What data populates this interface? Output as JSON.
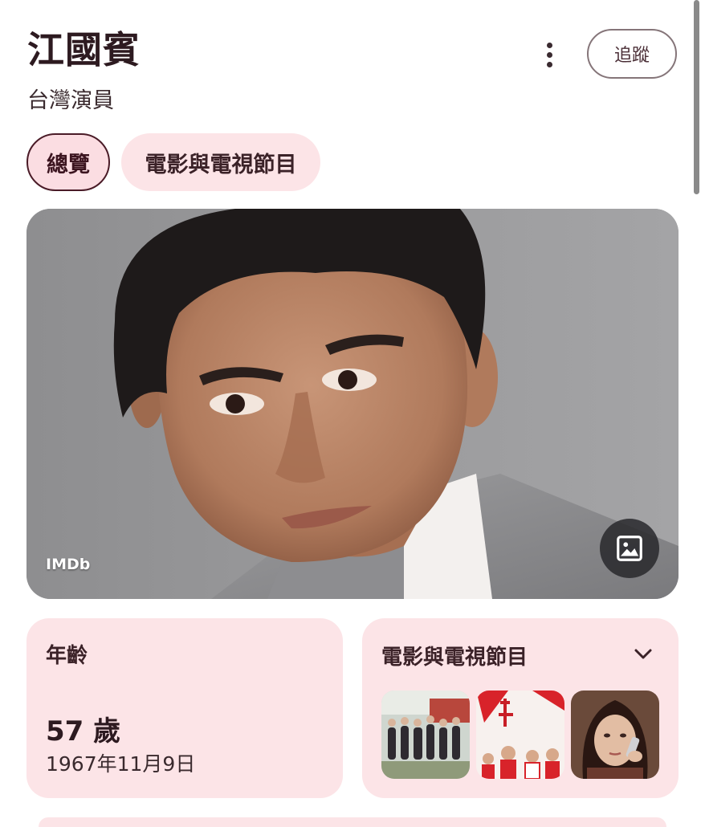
{
  "header": {
    "title": "江國賓",
    "subtitle": "台灣演員",
    "more_icon": "more-vert-icon",
    "follow_label": "追蹤"
  },
  "tabs": [
    {
      "label": "總覽",
      "selected": true
    },
    {
      "label": "電影與電視節目",
      "selected": false
    }
  ],
  "hero": {
    "source_label": "IMDb",
    "image_button_icon": "image-icon"
  },
  "age_card": {
    "label": "年齡",
    "value": "57 歲",
    "birth_date": "1967年11月9日"
  },
  "films_card": {
    "label": "電影與電視節目",
    "expand_icon": "chevron-down-icon",
    "thumbnail_count": 3
  },
  "colors": {
    "card_background": "#fce4e7",
    "selected_tab_border": "#4a1b27",
    "title_text": "#2d1a20"
  }
}
